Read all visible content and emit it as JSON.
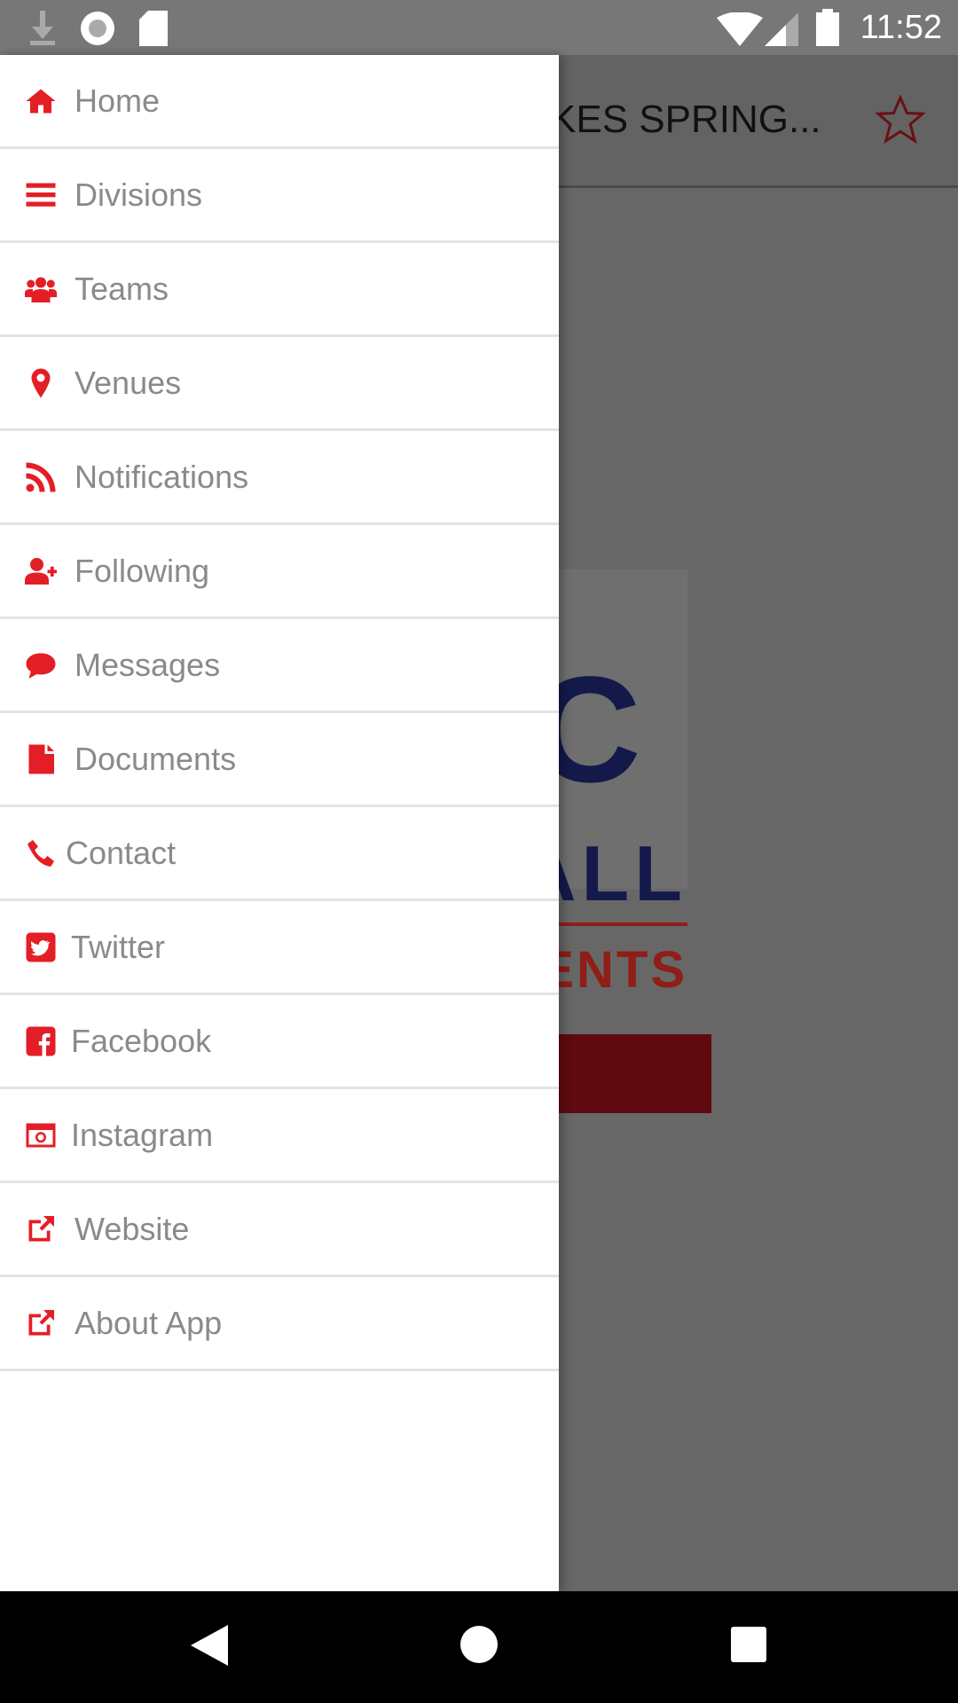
{
  "status_bar": {
    "time": "11:52",
    "icons": [
      "download-icon",
      "record-icon",
      "sd-card-icon",
      "wifi-icon",
      "signal-icon",
      "battery-icon"
    ]
  },
  "app_bar": {
    "title": "KES SPRING...",
    "action_icon": "star-outline-icon"
  },
  "background_logo": {
    "big_letter": "C",
    "line1": "ALL",
    "line2": "ENTS"
  },
  "colors": {
    "accent": "#e41e26",
    "text": "#8a8a8a",
    "divider": "#e3e3e3"
  },
  "drawer": {
    "items": [
      {
        "label": "Home",
        "icon": "home-icon"
      },
      {
        "label": "Divisions",
        "icon": "bars-icon"
      },
      {
        "label": "Teams",
        "icon": "users-icon"
      },
      {
        "label": "Venues",
        "icon": "map-pin-icon"
      },
      {
        "label": "Notifications",
        "icon": "rss-icon"
      },
      {
        "label": "Following",
        "icon": "user-plus-icon"
      },
      {
        "label": "Messages",
        "icon": "comment-icon"
      },
      {
        "label": "Documents",
        "icon": "file-icon"
      },
      {
        "label": "Contact",
        "icon": "phone-icon"
      },
      {
        "label": "Twitter",
        "icon": "twitter-icon"
      },
      {
        "label": "Facebook",
        "icon": "facebook-icon"
      },
      {
        "label": "Instagram",
        "icon": "instagram-icon"
      },
      {
        "label": "Website",
        "icon": "external-link-icon"
      },
      {
        "label": "About App",
        "icon": "external-link-icon"
      }
    ]
  },
  "nav_bar": {
    "buttons": [
      "back-icon",
      "home-circle-icon",
      "recents-icon"
    ]
  }
}
